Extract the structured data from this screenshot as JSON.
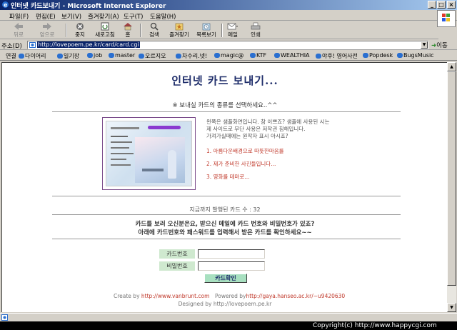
{
  "window": {
    "title": "인터넷 카드보내기 - Microsoft Internet Explorer",
    "controls": [
      "_",
      "□",
      "×"
    ]
  },
  "menu": [
    "파일(F)",
    "편집(E)",
    "보기(V)",
    "즐겨찾기(A)",
    "도구(T)",
    "도움말(H)"
  ],
  "toolbar": [
    {
      "label": "뒤로",
      "icon": "back-arrow-icon",
      "disabled": true
    },
    {
      "label": "앞으로",
      "icon": "forward-arrow-icon",
      "disabled": true
    },
    {
      "label": "중지",
      "icon": "stop-icon",
      "disabled": false
    },
    {
      "label": "새로고침",
      "icon": "refresh-icon",
      "disabled": false
    },
    {
      "label": "홈",
      "icon": "home-icon",
      "disabled": false
    },
    {
      "label": "검색",
      "icon": "search-icon",
      "disabled": false
    },
    {
      "label": "즐겨찾기",
      "icon": "favorites-icon",
      "disabled": false
    },
    {
      "label": "목록보기",
      "icon": "history-icon",
      "disabled": false
    },
    {
      "label": "메일",
      "icon": "mail-icon",
      "disabled": false
    },
    {
      "label": "인쇄",
      "icon": "print-icon",
      "disabled": false
    }
  ],
  "address": {
    "label": "주소(D)",
    "url": "http://lovepoem.pe.kr/card/card.cgi",
    "go_label": "이동"
  },
  "links": {
    "label": "연결",
    "items": [
      "다이어리",
      "일기장",
      "job",
      "master",
      "오르지오",
      "차수리.넷!",
      "magic@",
      "KTF",
      "WEALTHIA",
      "야후! 영어사전",
      "Popdesk",
      "BugsMusic"
    ]
  },
  "page": {
    "title": "인터넷 카드 보내기...",
    "subtitle": "※ 보내실 카드의 종류를 선택하세요..^^",
    "description": [
      "왼쪽은 샘플화면입니다. 참 이쁘죠? 샘플에 사용된 시는",
      "제 사이트로 무단 사용은 저작권 침해입니다.",
      "가져가실때에는 원작자 표시 아시죠?"
    ],
    "options": [
      "1. 아름다운배경으로 따뜻한마음를",
      "2. 제가 준비한 사진들입니다...",
      "3. 영화를 테마로..."
    ],
    "issued_count": "지금까지 발행된 카드 수 : 32",
    "guide_line1": "카드를 보러 오신분은요, 받으신 메일에 카드 번호와 비밀번호가 있죠?",
    "guide_line2": "아래에 카드번호와 패스워드를 입력해서 받은 카드를 확인하세요~~",
    "card_number_label": "카드번호",
    "password_label": "비밀번호",
    "confirm_label": "카드확인",
    "credit_create_prefix": "Create by ",
    "credit_create_link": "http://www.vanbrunt.com",
    "credit_powered_prefix": "Powered by",
    "credit_powered_link": "http://gaya.hanseo.ac.kr/~u9420630",
    "designed_by": "Designed by http://lovepoem.pe.kr"
  },
  "footer": {
    "copyright": "Copyright(c) http://www.happycgi.com"
  },
  "colors": {
    "title_bar": "#0a246a",
    "page_title": "#1e2d6a",
    "option_text": "#c0392b",
    "field_label_bg": "#cfe9cf",
    "confirm_bg": "#a8e0c0"
  }
}
